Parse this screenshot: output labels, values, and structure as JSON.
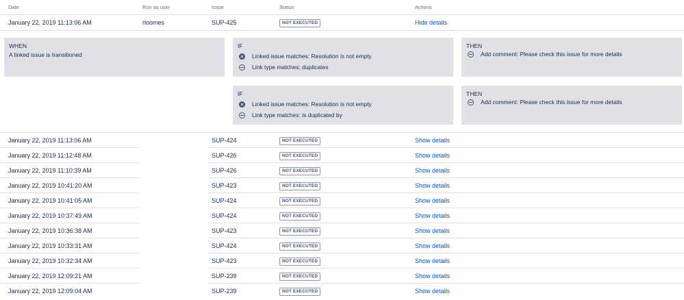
{
  "columns": {
    "date": "Date",
    "user": "Run as user",
    "issue": "Issue",
    "status": "Status",
    "actions": "Actions"
  },
  "expanded_row": {
    "date": "January 22, 2019 11:13:06 AM",
    "user": "rloomes",
    "issue": "SUP-425",
    "status": "NOT EXECUTED",
    "action": "Hide details"
  },
  "details": {
    "when": {
      "title": "WHEN",
      "text": "A linked issue is transitioned"
    },
    "rules": [
      {
        "if_title": "IF",
        "conditions": [
          {
            "icon": "x-circle-icon",
            "text": "Linked issue matches: Resolution is not empty"
          },
          {
            "icon": "minus-circle-icon",
            "text": "Link type matches: duplicates"
          }
        ],
        "then_title": "THEN",
        "actions": [
          {
            "icon": "minus-circle-icon",
            "text": "Add comment: Please check this issue for more details"
          }
        ]
      },
      {
        "if_title": "IF",
        "conditions": [
          {
            "icon": "x-circle-icon",
            "text": "Linked issue matches: Resolution is not empty"
          },
          {
            "icon": "minus-circle-icon",
            "text": "Link type matches: is duplicated by"
          }
        ],
        "then_title": "THEN",
        "actions": [
          {
            "icon": "minus-circle-icon",
            "text": "Add comment: Please check this issue for more details"
          }
        ]
      }
    ]
  },
  "rows": [
    {
      "date": "January 22, 2019 11:13:06 AM",
      "user": "",
      "issue": "SUP-424",
      "status": "NOT EXECUTED",
      "action": "Show details"
    },
    {
      "date": "January 22, 2019 11:12:48 AM",
      "user": "",
      "issue": "SUP-426",
      "status": "NOT EXECUTED",
      "action": "Show details"
    },
    {
      "date": "January 22, 2019 11:10:39 AM",
      "user": "",
      "issue": "SUP-426",
      "status": "NOT EXECUTED",
      "action": "Show details"
    },
    {
      "date": "January 22, 2019 10:41:20 AM",
      "user": "",
      "issue": "SUP-423",
      "status": "NOT EXECUTED",
      "action": "Show details"
    },
    {
      "date": "January 22, 2019 10:41:05 AM",
      "user": "",
      "issue": "SUP-424",
      "status": "NOT EXECUTED",
      "action": "Show details"
    },
    {
      "date": "January 22, 2019 10:37:49 AM",
      "user": "",
      "issue": "SUP-424",
      "status": "NOT EXECUTED",
      "action": "Show details"
    },
    {
      "date": "January 22, 2019 10:36:38 AM",
      "user": "",
      "issue": "SUP-423",
      "status": "NOT EXECUTED",
      "action": "Show details"
    },
    {
      "date": "January 22, 2019 10:33:31 AM",
      "user": "",
      "issue": "SUP-424",
      "status": "NOT EXECUTED",
      "action": "Show details"
    },
    {
      "date": "January 22, 2019 10:32:34 AM",
      "user": "",
      "issue": "SUP-423",
      "status": "NOT EXECUTED",
      "action": "Show details"
    },
    {
      "date": "January 22, 2019 12:09:21 AM",
      "user": "",
      "issue": "SUP-239",
      "status": "NOT EXECUTED",
      "action": "Show details"
    },
    {
      "date": "January 22, 2019 12:09:04 AM",
      "user": "",
      "issue": "SUP-239",
      "status": "NOT EXECUTED",
      "action": "Show details"
    }
  ]
}
